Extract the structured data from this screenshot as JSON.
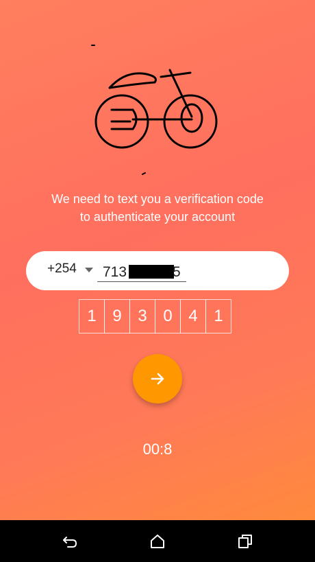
{
  "message": {
    "line1": "We need to text you a verification code",
    "line2": "to authenticate your account"
  },
  "phone": {
    "country_code": "+254",
    "number_prefix": "713",
    "number_suffix": "5"
  },
  "code": {
    "digits": [
      "1",
      "9",
      "3",
      "0",
      "4",
      "1"
    ]
  },
  "timer": "00:8",
  "colors": {
    "accent": "#ff9800",
    "gradient_top": "#ff7f5e",
    "gradient_bottom": "#ff8a3c"
  },
  "navbar": {
    "icons": [
      "back-icon",
      "home-icon",
      "recents-icon"
    ]
  }
}
